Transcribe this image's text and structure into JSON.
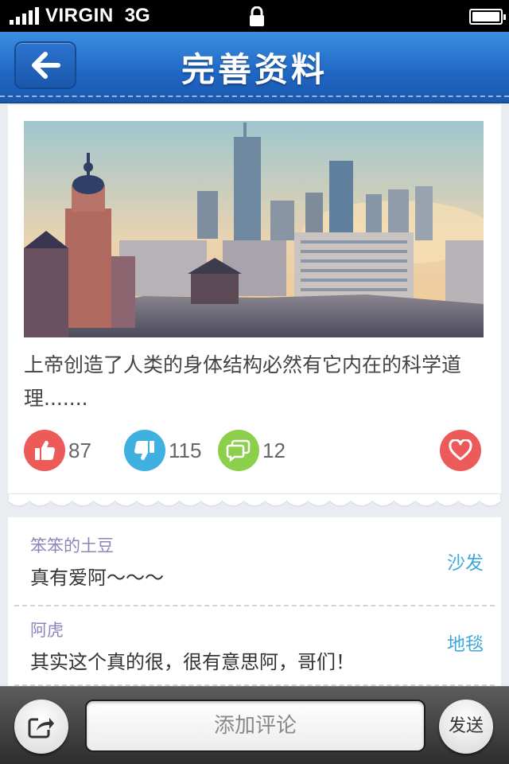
{
  "status_bar": {
    "carrier": "VIRGIN",
    "network": "3G",
    "signal_icon": "signal-bars-icon",
    "lock_icon": "lock-icon",
    "battery_icon": "battery-icon"
  },
  "nav": {
    "title": "完善资料",
    "back_icon": "arrow-left-icon",
    "bar_color": "#1f66c4"
  },
  "post": {
    "image": "city-skyline-photo",
    "text": "上帝创造了人类的身体结构必然有它内在的科学道理.......",
    "likes": "87",
    "dislikes": "115",
    "comments": "12",
    "like_color": "#ec5a5a",
    "dislike_color": "#3fb0e0",
    "comment_color": "#8ccf4a",
    "favorite_color": "#ec5a5a"
  },
  "comments": [
    {
      "author": "笨笨的土豆",
      "text": "真有爱阿～～～",
      "tag": "沙发"
    },
    {
      "author": "阿虎",
      "text": "其实这个真的很，很有意思阿，哥们！",
      "tag": "地毯"
    }
  ],
  "bottom_bar": {
    "share_icon": "share-icon",
    "input_placeholder": "添加评论",
    "send_label": "发送"
  }
}
